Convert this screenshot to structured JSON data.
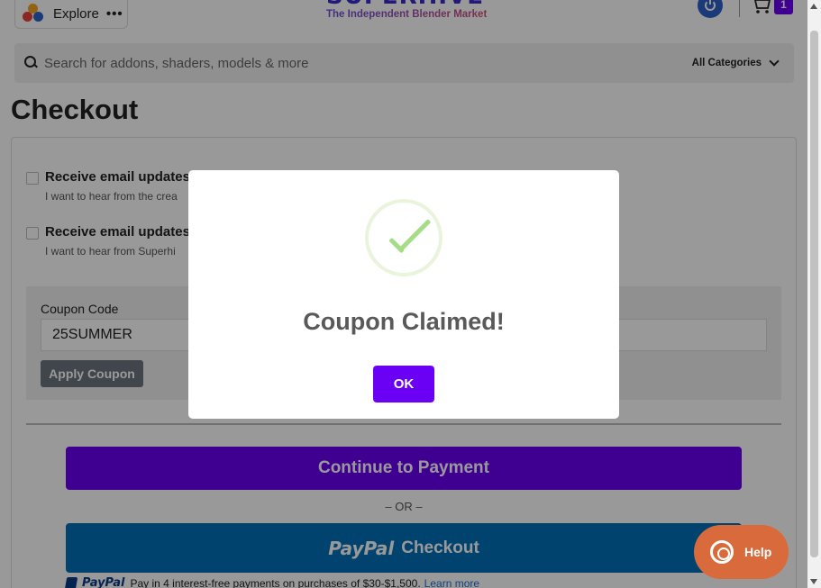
{
  "header": {
    "explore_label": "Explore",
    "explore_more": "•••",
    "brand_logo": "SUPERHIVE",
    "brand_tagline": "The Independent Blender Market",
    "cart_count": "1"
  },
  "search": {
    "placeholder": "Search for addons, shaders, models & more",
    "category": "All Categories"
  },
  "page": {
    "title": "Checkout"
  },
  "options": [
    {
      "label": "Receive email updates c",
      "desc": "I want to hear from the crea"
    },
    {
      "label": "Receive email updates f",
      "desc": "I want to hear from Superhi"
    }
  ],
  "coupon": {
    "label": "Coupon Code",
    "value": "25SUMMER",
    "apply_label": "Apply Coupon"
  },
  "payment": {
    "continue_label": "Continue to Payment",
    "or_text": "– OR –",
    "paypal_word": "PayPal",
    "paypal_action": "Checkout",
    "paylater_word": "PayPal",
    "paylater_text": "Pay in 4 interest-free payments on purchases of $30-$1,500.",
    "paylater_link": "Learn more"
  },
  "modal": {
    "title": "Coupon Claimed!",
    "ok_label": "OK"
  },
  "help": {
    "label": "Help"
  },
  "colors": {
    "accent": "#6a00f4",
    "paypal": "#0070ba",
    "help": "#d96a3b",
    "success": "#a5dc86"
  }
}
